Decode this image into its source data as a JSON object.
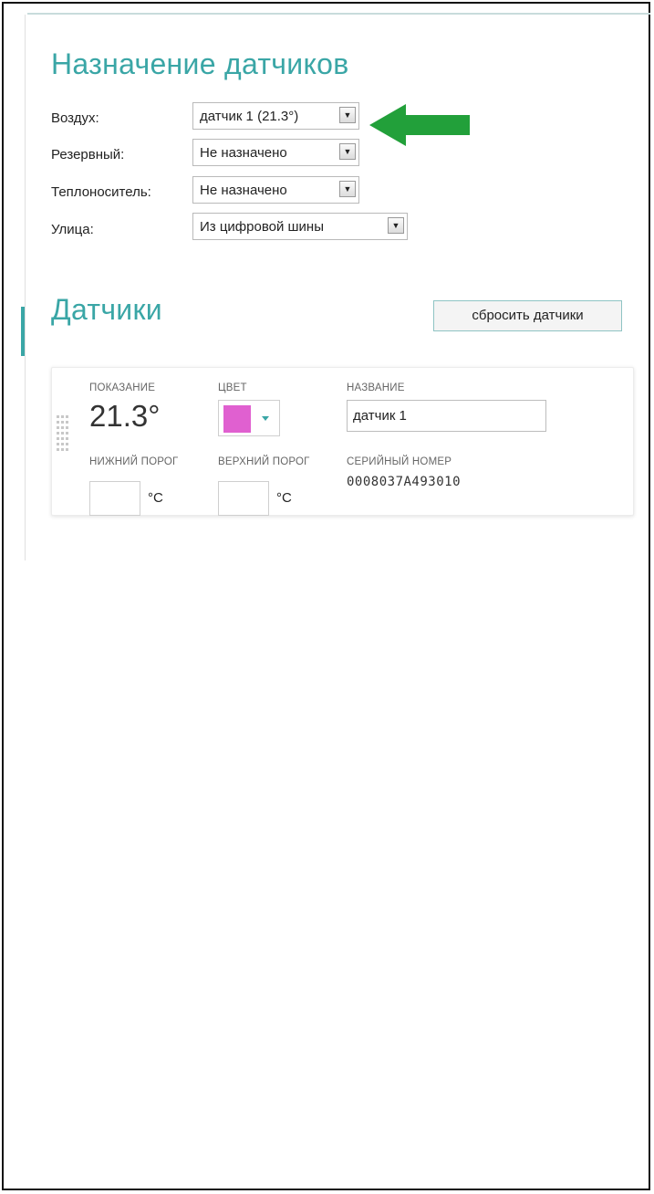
{
  "assignment": {
    "title": "Назначение датчиков",
    "rows": [
      {
        "label": "Воздух:",
        "value": "датчик 1 (21.3°)"
      },
      {
        "label": "Резервный:",
        "value": "Не назначено"
      },
      {
        "label": "Теплоноситель:",
        "value": "Не назначено"
      },
      {
        "label": "Улица:",
        "value": "Из цифровой шины"
      }
    ],
    "dropdown_icon": "▼"
  },
  "annotation": {
    "arrow_icon": "green-arrow-left",
    "color": "#22a03a"
  },
  "sensors": {
    "title": "Датчики",
    "reset_button": "сбросить датчики",
    "card": {
      "reading_caption": "ПОКАЗАНИЕ",
      "reading_value": "21.3°",
      "color_caption": "ЦВЕТ",
      "color_value": "#e060d0",
      "name_caption": "НАЗВАНИЕ",
      "name_value": "датчик 1",
      "lower_caption": "НИЖНИЙ ПОРОГ",
      "lower_value": "",
      "upper_caption": "ВЕРХНИЙ ПОРОГ",
      "upper_value": "",
      "unit": "°C",
      "serial_caption": "СЕРИЙНЫЙ НОМЕР",
      "serial_value": "0008037A493010"
    }
  },
  "colors": {
    "accent": "#3aa6a6"
  }
}
